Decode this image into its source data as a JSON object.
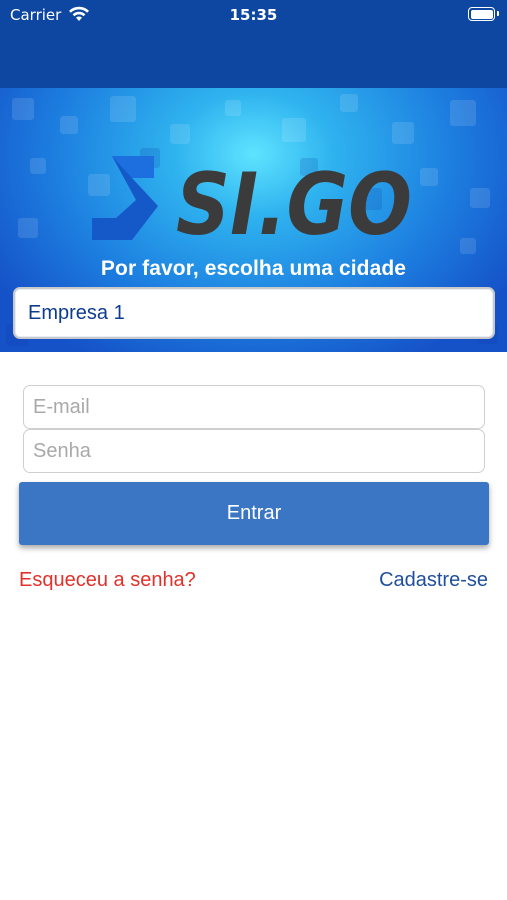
{
  "status_bar": {
    "carrier": "Carrier",
    "time": "15:35",
    "icons": [
      "wifi-icon",
      "battery-icon"
    ]
  },
  "banner": {
    "logo_text": "SI.GO",
    "prompt": "Por favor, escolha uma cidade",
    "selected_city": "Empresa 1"
  },
  "login": {
    "email_placeholder": "E-mail",
    "password_placeholder": "Senha",
    "email_value": "",
    "password_value": "",
    "submit_label": "Entrar",
    "forgot_label": "Esqueceu a senha?",
    "signup_label": "Cadastre-se"
  },
  "colors": {
    "header": "#0d47a1",
    "button": "#3a76c4",
    "forgot_link": "#e0312b",
    "signup_link": "#1f4f9c",
    "logo_text": "#3b3b3b"
  }
}
